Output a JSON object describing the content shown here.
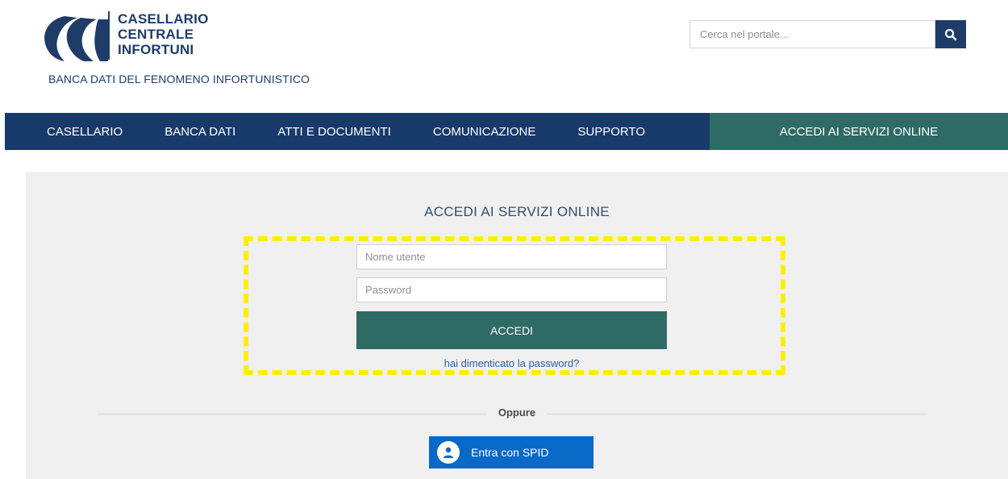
{
  "header": {
    "brand_line1": "CASELLARIO",
    "brand_line2": "CENTRALE",
    "brand_line3": "INFORTUNI",
    "tagline": "BANCA DATI DEL FENOMENO INFORTUNISTICO",
    "logo_icon": "cci-logo-icon",
    "search": {
      "placeholder": "Cerca nel portale...",
      "value": "",
      "button_icon": "search-icon"
    }
  },
  "nav": {
    "items": [
      {
        "label": "CASELLARIO"
      },
      {
        "label": "BANCA DATI"
      },
      {
        "label": "ATTI E DOCUMENTI"
      },
      {
        "label": "COMUNICAZIONE"
      },
      {
        "label": "SUPPORTO"
      }
    ],
    "cta_label": "ACCEDI AI SERVIZI ONLINE"
  },
  "login": {
    "title": "ACCEDI AI SERVIZI ONLINE",
    "username_placeholder": "Nome utente",
    "username_value": "",
    "password_placeholder": "Password",
    "password_value": "",
    "submit_label": "ACCEDI",
    "forgot_label": "hai dimenticato la password?",
    "or_label": "Oppure",
    "spid_label": "Entra con SPID",
    "spid_icon": "user-icon"
  },
  "colors": {
    "navy": "#183a6b",
    "teal": "#2f6b66",
    "spid_blue": "#0a69c7",
    "highlight_yellow": "#ffee00",
    "link_blue": "#2b5fa6",
    "panel_gray": "#f0f0f0"
  }
}
